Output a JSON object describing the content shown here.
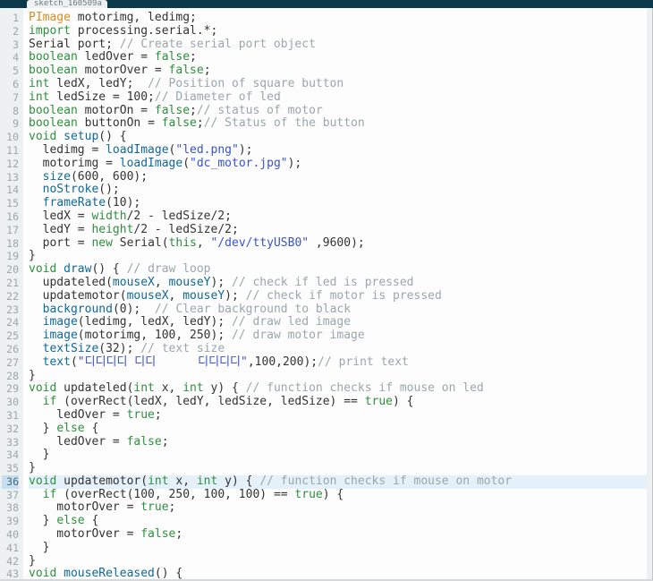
{
  "tab": {
    "label": "sketch_160509a"
  },
  "current_line": 36,
  "code": [
    [
      [
        "tp",
        "PImage"
      ],
      [
        "",
        " motorimg, ledimg;"
      ]
    ],
    [
      [
        "kw",
        "import"
      ],
      [
        "",
        " processing.serial.*;"
      ]
    ],
    [
      [
        "",
        "Serial port; "
      ],
      [
        "cm",
        "// Create serial port object"
      ]
    ],
    [
      [
        "kw",
        "boolean"
      ],
      [
        "",
        " ledOver = "
      ],
      [
        "kw",
        "false"
      ],
      [
        "",
        ";"
      ]
    ],
    [
      [
        "kw",
        "boolean"
      ],
      [
        "",
        " motorOver = "
      ],
      [
        "kw",
        "false"
      ],
      [
        "",
        ";"
      ]
    ],
    [
      [
        "kw",
        "int"
      ],
      [
        "",
        " ledX, ledY;  "
      ],
      [
        "cm",
        "// Position of square button"
      ]
    ],
    [
      [
        "kw",
        "int"
      ],
      [
        "",
        " ledSize = 100;"
      ],
      [
        "cm",
        "// Diameter of led"
      ]
    ],
    [
      [
        "kw",
        "boolean"
      ],
      [
        "",
        " motorOn = "
      ],
      [
        "kw",
        "false"
      ],
      [
        "",
        ";"
      ],
      [
        "cm",
        "// status of motor"
      ]
    ],
    [
      [
        "kw",
        "boolean"
      ],
      [
        "",
        " buttonOn = "
      ],
      [
        "kw",
        "false"
      ],
      [
        "",
        ";"
      ],
      [
        "cm",
        "// Status of the button"
      ]
    ],
    [
      [
        "kw",
        "void"
      ],
      [
        "",
        " "
      ],
      [
        "fb",
        "setup"
      ],
      [
        "",
        "() {"
      ]
    ],
    [
      [
        "",
        "  ledimg = "
      ],
      [
        "fb",
        "loadImage"
      ],
      [
        "",
        "("
      ],
      [
        "str",
        "\"led.png\""
      ],
      [
        "",
        ");"
      ]
    ],
    [
      [
        "",
        "  motorimg = "
      ],
      [
        "fb",
        "loadImage"
      ],
      [
        "",
        "("
      ],
      [
        "str",
        "\"dc_motor.jpg\""
      ],
      [
        "",
        ");"
      ]
    ],
    [
      [
        "",
        "  "
      ],
      [
        "fb",
        "size"
      ],
      [
        "",
        "(600, 600);"
      ]
    ],
    [
      [
        "",
        "  "
      ],
      [
        "fb",
        "noStroke"
      ],
      [
        "",
        "();"
      ]
    ],
    [
      [
        "",
        "  "
      ],
      [
        "fb",
        "frameRate"
      ],
      [
        "",
        "(10);"
      ]
    ],
    [
      [
        "",
        "  ledX = "
      ],
      [
        "kw",
        "width"
      ],
      [
        "",
        "/2 - ledSize/2;"
      ]
    ],
    [
      [
        "",
        "  ledY = "
      ],
      [
        "kw",
        "height"
      ],
      [
        "",
        "/2 - ledSize/2;"
      ]
    ],
    [
      [
        "",
        "  port = "
      ],
      [
        "kw",
        "new"
      ],
      [
        "",
        " Serial("
      ],
      [
        "kw",
        "this"
      ],
      [
        "",
        ", "
      ],
      [
        "str",
        "\"/dev/ttyUSB0\""
      ],
      [
        "",
        " ,9600);"
      ]
    ],
    [
      [
        "",
        "}"
      ]
    ],
    [
      [
        "kw",
        "void"
      ],
      [
        "",
        " "
      ],
      [
        "fb",
        "draw"
      ],
      [
        "",
        "() { "
      ],
      [
        "cm",
        "// draw loop"
      ]
    ],
    [
      [
        "",
        "  updateled("
      ],
      [
        "fb",
        "mouseX"
      ],
      [
        "",
        ", "
      ],
      [
        "fb",
        "mouseY"
      ],
      [
        "",
        "); "
      ],
      [
        "cm",
        "// check if led is pressed"
      ]
    ],
    [
      [
        "",
        "  updatemotor("
      ],
      [
        "fb",
        "mouseX"
      ],
      [
        "",
        ", "
      ],
      [
        "fb",
        "mouseY"
      ],
      [
        "",
        "); "
      ],
      [
        "cm",
        "// check if motor is pressed"
      ]
    ],
    [
      [
        "",
        "  "
      ],
      [
        "fb",
        "background"
      ],
      [
        "",
        "(0);  "
      ],
      [
        "cm",
        "// Clear background to black"
      ]
    ],
    [
      [
        "",
        "  "
      ],
      [
        "fb",
        "image"
      ],
      [
        "",
        "(ledimg, ledX, ledY); "
      ],
      [
        "cm",
        "// draw led image"
      ]
    ],
    [
      [
        "",
        "  "
      ],
      [
        "fb",
        "image"
      ],
      [
        "",
        "(motorimg, 100, 250); "
      ],
      [
        "cm",
        "// draw motor image"
      ]
    ],
    [
      [
        "",
        "  "
      ],
      [
        "fb",
        "textSize"
      ],
      [
        "",
        "(32); "
      ],
      [
        "cm",
        "// text size"
      ]
    ],
    [
      [
        "",
        "  "
      ],
      [
        "fb",
        "text"
      ],
      [
        "",
        "("
      ],
      [
        "str",
        "\"디디디디 디디      디디디디\""
      ],
      [
        "",
        ",100,200);"
      ],
      [
        "cm",
        "// print text"
      ]
    ],
    [
      [
        "",
        "}"
      ]
    ],
    [
      [
        "kw",
        "void"
      ],
      [
        "",
        " updateled("
      ],
      [
        "kw",
        "int"
      ],
      [
        "",
        " x, "
      ],
      [
        "kw",
        "int"
      ],
      [
        "",
        " y) { "
      ],
      [
        "cm",
        "// function checks if mouse on led"
      ]
    ],
    [
      [
        "",
        "  "
      ],
      [
        "kw",
        "if"
      ],
      [
        "",
        " (overRect(ledX, ledY, ledSize, ledSize) == "
      ],
      [
        "kw",
        "true"
      ],
      [
        "",
        ") {"
      ]
    ],
    [
      [
        "",
        "    ledOver = "
      ],
      [
        "kw",
        "true"
      ],
      [
        "",
        ";"
      ]
    ],
    [
      [
        "",
        "  } "
      ],
      [
        "kw",
        "else"
      ],
      [
        "",
        " {"
      ]
    ],
    [
      [
        "",
        "    ledOver = "
      ],
      [
        "kw",
        "false"
      ],
      [
        "",
        ";"
      ]
    ],
    [
      [
        "",
        "  }"
      ]
    ],
    [
      [
        "",
        "}"
      ]
    ],
    [
      [
        "kw",
        "void"
      ],
      [
        "",
        " updatemotor("
      ],
      [
        "kw",
        "int"
      ],
      [
        "",
        " x, "
      ],
      [
        "kw",
        "int"
      ],
      [
        "",
        " y) { "
      ],
      [
        "cm",
        "// function checks if mouse on motor"
      ]
    ],
    [
      [
        "",
        "  "
      ],
      [
        "kw",
        "if"
      ],
      [
        "",
        " (overRect(100, 250, 100, 100) == "
      ],
      [
        "kw",
        "true"
      ],
      [
        "",
        ") {"
      ]
    ],
    [
      [
        "",
        "    motorOver = "
      ],
      [
        "kw",
        "true"
      ],
      [
        "",
        ";"
      ]
    ],
    [
      [
        "",
        "  } "
      ],
      [
        "kw",
        "else"
      ],
      [
        "",
        " {"
      ]
    ],
    [
      [
        "",
        "    motorOver = "
      ],
      [
        "kw",
        "false"
      ],
      [
        "",
        ";"
      ]
    ],
    [
      [
        "",
        "  }"
      ]
    ],
    [
      [
        "",
        "}"
      ]
    ],
    [
      [
        "kw",
        "void"
      ],
      [
        "",
        " "
      ],
      [
        "fb",
        "mouseReleased"
      ],
      [
        "",
        "() {"
      ]
    ]
  ]
}
